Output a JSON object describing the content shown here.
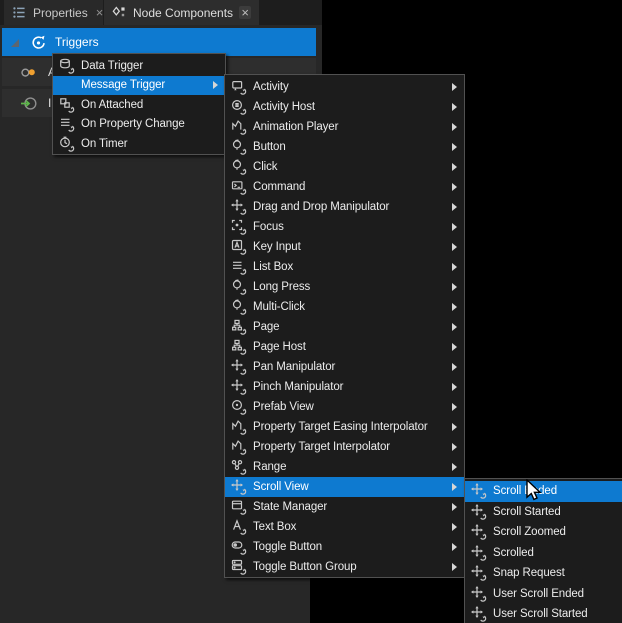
{
  "colors": {
    "accent": "#0e7ad0",
    "menu_background": "#1c1c1c",
    "menu_border": "#515151",
    "panel_background": "#272727",
    "row_background": "#2e2e2e",
    "tabbar_background": "#1d1d1d",
    "menu_text": "#ececec",
    "animation_dot_orange": "#f0a030",
    "input_arrow_green": "#5db54a"
  },
  "panel": {
    "tabs": [
      {
        "label": "Properties",
        "icon": "properties-list-icon",
        "close_label": "×",
        "active": false
      },
      {
        "label": "Node Components",
        "icon": "node-components-icon",
        "close_label": "×",
        "active": true
      }
    ],
    "sections": [
      {
        "label": "Triggers",
        "icon": "trigger-icon",
        "selected": true,
        "expanded": true
      },
      {
        "label": "A",
        "icon": "animation-icon",
        "note": "truncated by menu overlay"
      },
      {
        "label": "In",
        "icon": "input-icon",
        "note": "truncated by menu overlay"
      }
    ]
  },
  "menus": [
    {
      "id": "menu1",
      "items": [
        {
          "label": "Data Trigger",
          "icon": "data-trigger-icon",
          "submenu": false,
          "highlighted": false
        },
        {
          "label": "Message Trigger",
          "icon": "",
          "submenu": true,
          "highlighted": true
        },
        {
          "label": "On Attached",
          "icon": "on-attached-icon",
          "submenu": false,
          "highlighted": false
        },
        {
          "label": "On Property Change",
          "icon": "on-property-change-icon",
          "submenu": false,
          "highlighted": false
        },
        {
          "label": "On Timer",
          "icon": "on-timer-icon",
          "submenu": false,
          "highlighted": false
        }
      ]
    },
    {
      "id": "menu2",
      "items": [
        {
          "label": "Activity",
          "icon": "activity-icon",
          "submenu": true,
          "highlighted": false
        },
        {
          "label": "Activity Host",
          "icon": "activity-host-icon",
          "submenu": true,
          "highlighted": false
        },
        {
          "label": "Animation Player",
          "icon": "animation-player-icon",
          "submenu": true,
          "highlighted": false
        },
        {
          "label": "Button",
          "icon": "button-icon",
          "submenu": true,
          "highlighted": false
        },
        {
          "label": "Click",
          "icon": "click-icon",
          "submenu": true,
          "highlighted": false
        },
        {
          "label": "Command",
          "icon": "command-icon",
          "submenu": true,
          "highlighted": false
        },
        {
          "label": "Drag and Drop Manipulator",
          "icon": "drag-and-drop-manipulator-icon",
          "submenu": true,
          "highlighted": false
        },
        {
          "label": "Focus",
          "icon": "focus-icon",
          "submenu": true,
          "highlighted": false
        },
        {
          "label": "Key Input",
          "icon": "key-input-icon",
          "submenu": true,
          "highlighted": false
        },
        {
          "label": "List Box",
          "icon": "list-box-icon",
          "submenu": true,
          "highlighted": false
        },
        {
          "label": "Long Press",
          "icon": "long-press-icon",
          "submenu": true,
          "highlighted": false
        },
        {
          "label": "Multi-Click",
          "icon": "multi-click-icon",
          "submenu": true,
          "highlighted": false
        },
        {
          "label": "Page",
          "icon": "page-icon",
          "submenu": true,
          "highlighted": false
        },
        {
          "label": "Page Host",
          "icon": "page-host-icon",
          "submenu": true,
          "highlighted": false
        },
        {
          "label": "Pan Manipulator",
          "icon": "pan-manipulator-icon",
          "submenu": true,
          "highlighted": false
        },
        {
          "label": "Pinch Manipulator",
          "icon": "pinch-manipulator-icon",
          "submenu": true,
          "highlighted": false
        },
        {
          "label": "Prefab View",
          "icon": "prefab-view-icon",
          "submenu": true,
          "highlighted": false
        },
        {
          "label": "Property Target Easing Interpolator",
          "icon": "property-target-easing-interpolator-icon",
          "submenu": true,
          "highlighted": false
        },
        {
          "label": "Property Target Interpolator",
          "icon": "property-target-interpolator-icon",
          "submenu": true,
          "highlighted": false
        },
        {
          "label": "Range",
          "icon": "range-icon",
          "submenu": true,
          "highlighted": false
        },
        {
          "label": "Scroll View",
          "icon": "scroll-view-icon",
          "submenu": true,
          "highlighted": true
        },
        {
          "label": "State Manager",
          "icon": "state-manager-icon",
          "submenu": true,
          "highlighted": false
        },
        {
          "label": "Text Box",
          "icon": "text-box-icon",
          "submenu": true,
          "highlighted": false
        },
        {
          "label": "Toggle Button",
          "icon": "toggle-button-icon",
          "submenu": true,
          "highlighted": false
        },
        {
          "label": "Toggle Button Group",
          "icon": "toggle-button-group-icon",
          "submenu": true,
          "highlighted": false
        }
      ]
    },
    {
      "id": "menu3",
      "items": [
        {
          "label": "Scroll Ended",
          "icon": "scroll-ended-icon",
          "submenu": false,
          "highlighted": true
        },
        {
          "label": "Scroll Started",
          "icon": "scroll-started-icon",
          "submenu": false,
          "highlighted": false
        },
        {
          "label": "Scroll Zoomed",
          "icon": "scroll-zoomed-icon",
          "submenu": false,
          "highlighted": false
        },
        {
          "label": "Scrolled",
          "icon": "scrolled-icon",
          "submenu": false,
          "highlighted": false
        },
        {
          "label": "Snap Request",
          "icon": "snap-request-icon",
          "submenu": false,
          "highlighted": false
        },
        {
          "label": "User Scroll Ended",
          "icon": "user-scroll-ended-icon",
          "submenu": false,
          "highlighted": false
        },
        {
          "label": "User Scroll Started",
          "icon": "user-scroll-started-icon",
          "submenu": false,
          "highlighted": false
        }
      ]
    }
  ]
}
